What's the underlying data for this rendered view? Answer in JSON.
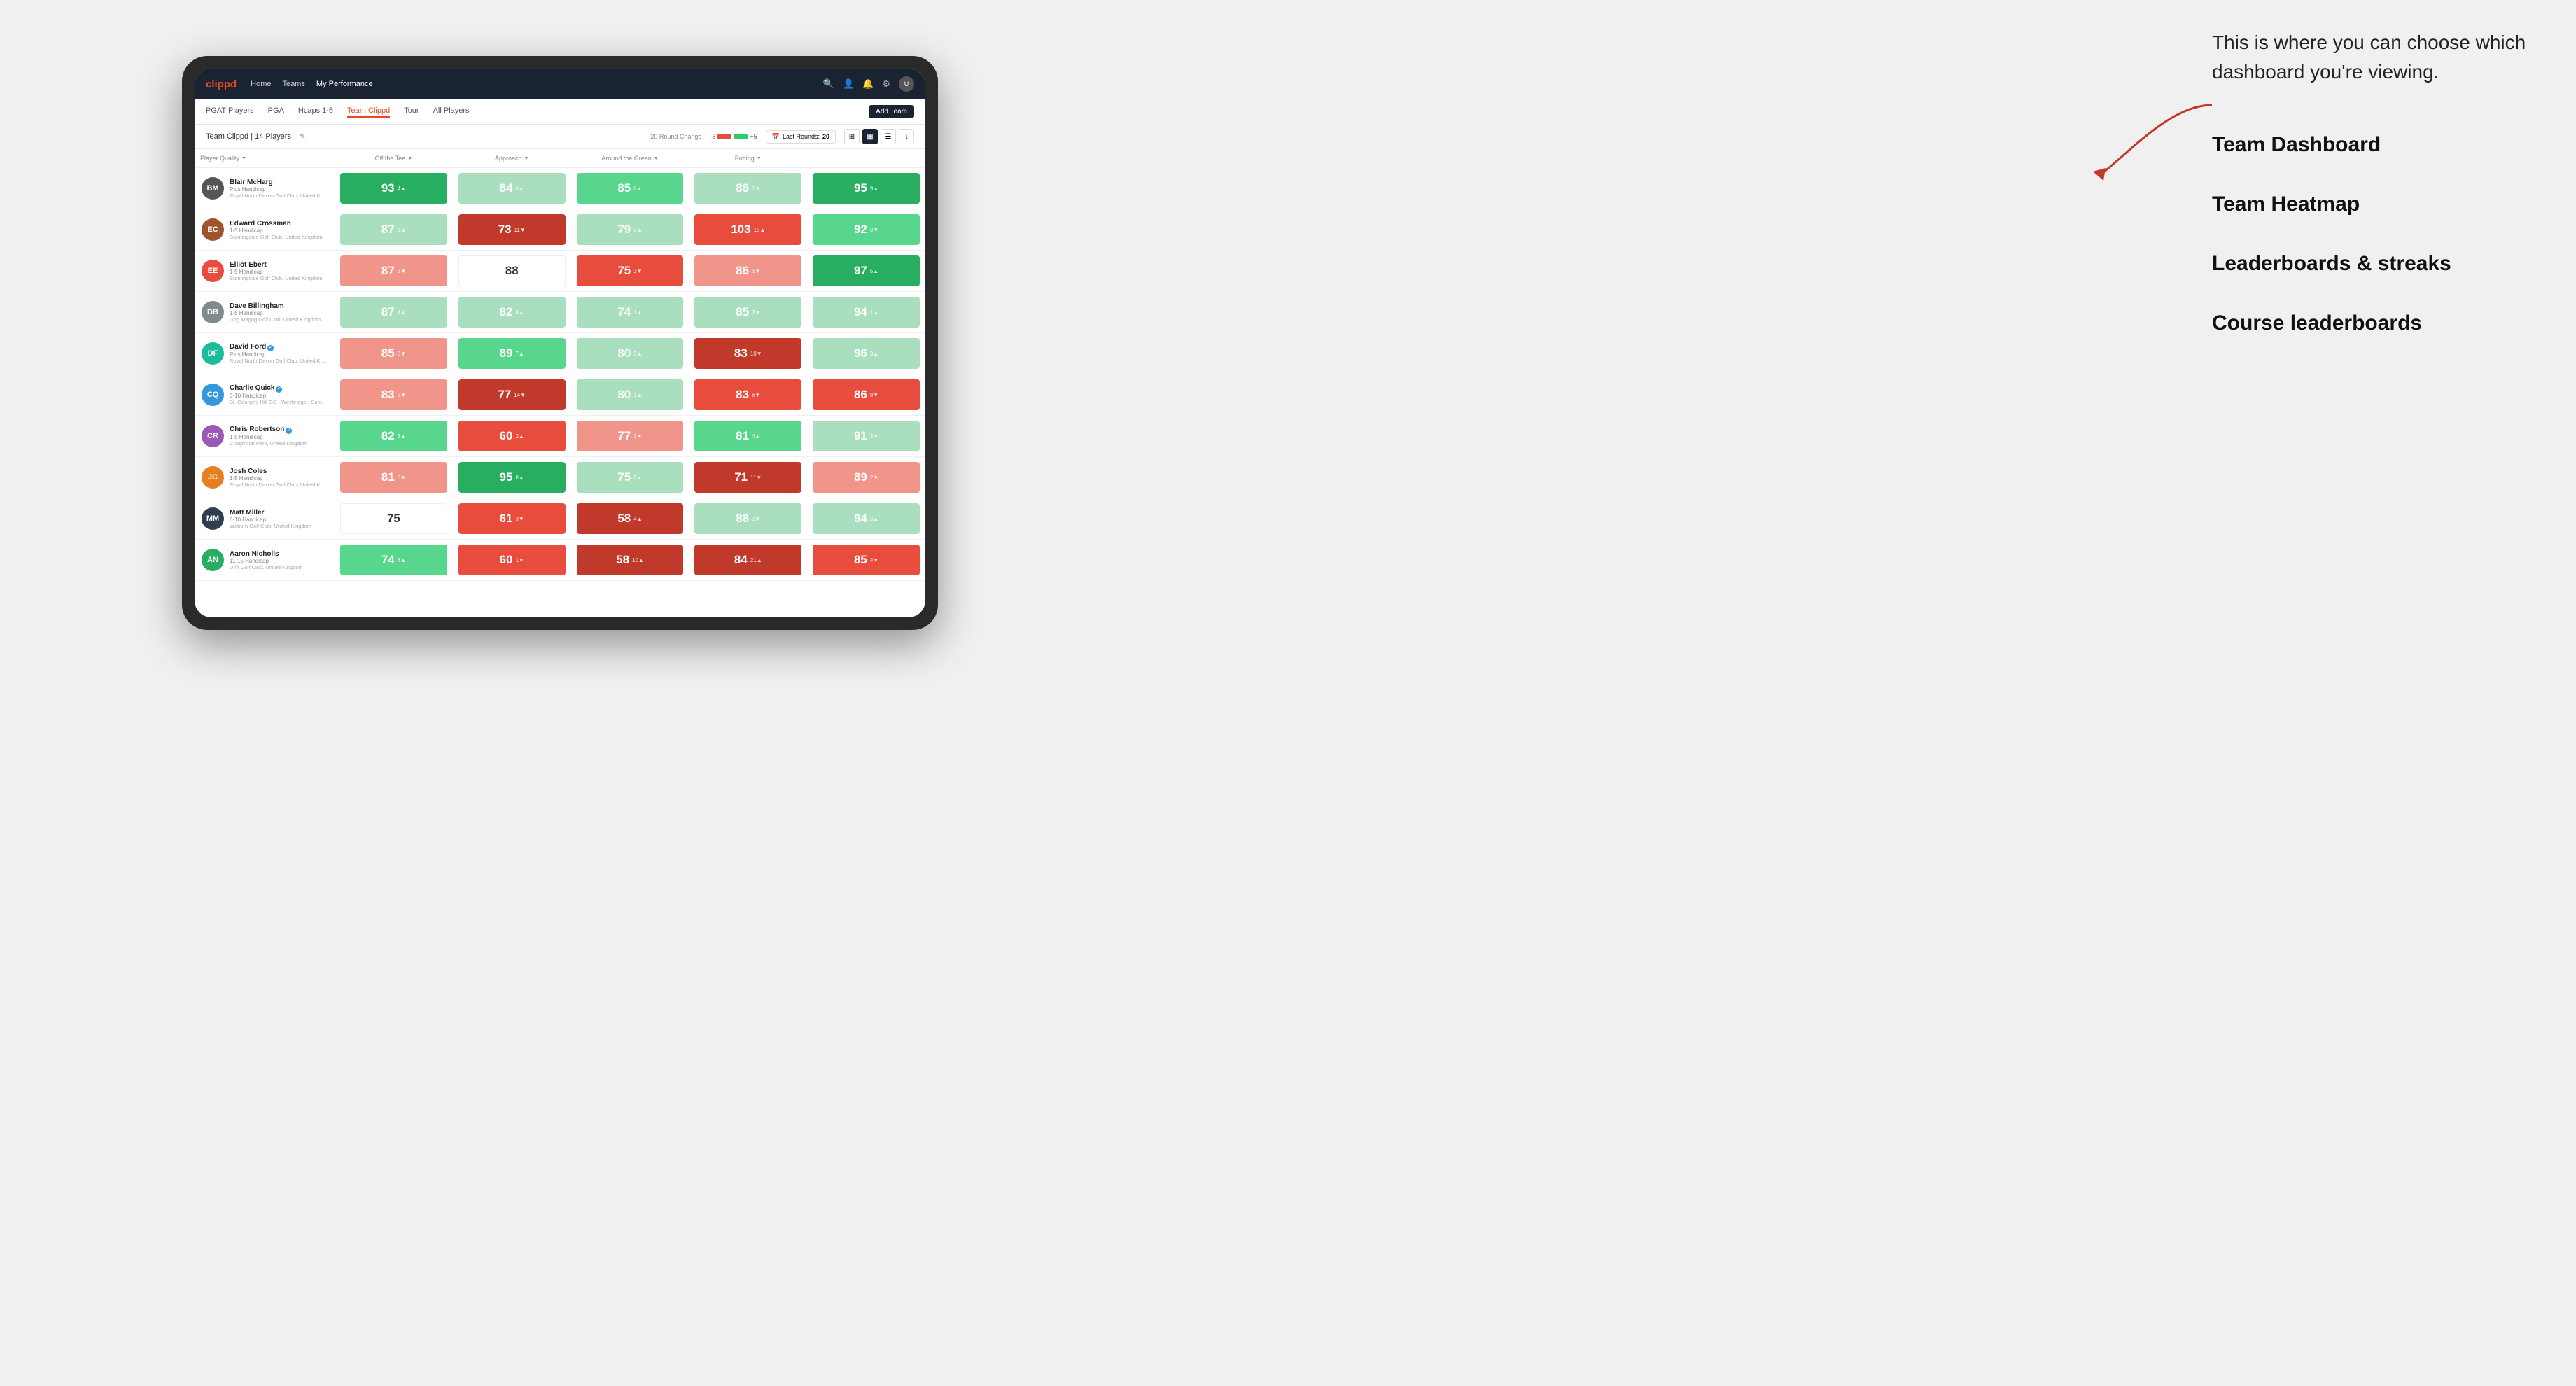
{
  "annotation": {
    "intro": "This is where you can choose which dashboard you're viewing.",
    "items": [
      "Team Dashboard",
      "Team Heatmap",
      "Leaderboards & streaks",
      "Course leaderboards"
    ]
  },
  "nav": {
    "logo": "clippd",
    "links": [
      "Home",
      "Teams",
      "My Performance"
    ],
    "active_link": "My Performance"
  },
  "sub_nav": {
    "links": [
      "PGAT Players",
      "PGA",
      "Hcaps 1-5",
      "Team Clippd",
      "Tour",
      "All Players"
    ],
    "active": "Team Clippd",
    "add_team_label": "Add Team"
  },
  "team_bar": {
    "team_name": "Team Clippd | 14 Players",
    "round_change_label": "20 Round Change",
    "neg_label": "-5",
    "pos_label": "+5",
    "last_rounds_label": "Last Rounds:",
    "last_rounds_value": "20"
  },
  "table": {
    "columns": [
      "Player Quality ▼",
      "Off the Tee ▼",
      "Approach ▼",
      "Around the Green ▼",
      "Putting ▼"
    ],
    "players": [
      {
        "name": "Blair McHarg",
        "handicap": "Plus Handicap",
        "club": "Royal North Devon Golf Club, United Kingdom",
        "initials": "BM",
        "avatar_color": "av-dark",
        "scores": [
          {
            "value": "93",
            "change": "4",
            "dir": "up",
            "color": "bg-green-strong"
          },
          {
            "value": "84",
            "change": "6",
            "dir": "up",
            "color": "bg-green-light"
          },
          {
            "value": "85",
            "change": "8",
            "dir": "up",
            "color": "bg-green-medium"
          },
          {
            "value": "88",
            "change": "1",
            "dir": "down",
            "color": "bg-green-light"
          },
          {
            "value": "95",
            "change": "9",
            "dir": "up",
            "color": "bg-green-strong"
          }
        ]
      },
      {
        "name": "Edward Crossman",
        "handicap": "1-5 Handicap",
        "club": "Sunningdale Golf Club, United Kingdom",
        "initials": "EC",
        "avatar_color": "av-brown",
        "scores": [
          {
            "value": "87",
            "change": "1",
            "dir": "up",
            "color": "bg-green-light"
          },
          {
            "value": "73",
            "change": "11",
            "dir": "down",
            "color": "bg-red-strong"
          },
          {
            "value": "79",
            "change": "9",
            "dir": "up",
            "color": "bg-green-light"
          },
          {
            "value": "103",
            "change": "15",
            "dir": "up",
            "color": "bg-red-medium"
          },
          {
            "value": "92",
            "change": "3",
            "dir": "down",
            "color": "bg-green-medium"
          }
        ]
      },
      {
        "name": "Elliot Ebert",
        "handicap": "1-5 Handicap",
        "club": "Sunningdale Golf Club, United Kingdom",
        "initials": "EE",
        "avatar_color": "av-red",
        "scores": [
          {
            "value": "87",
            "change": "3",
            "dir": "down",
            "color": "bg-red-light"
          },
          {
            "value": "88",
            "change": "",
            "dir": "none",
            "color": "bg-white"
          },
          {
            "value": "75",
            "change": "3",
            "dir": "down",
            "color": "bg-red-medium"
          },
          {
            "value": "86",
            "change": "6",
            "dir": "down",
            "color": "bg-red-light"
          },
          {
            "value": "97",
            "change": "5",
            "dir": "up",
            "color": "bg-green-strong"
          }
        ]
      },
      {
        "name": "Dave Billingham",
        "handicap": "1-5 Handicap",
        "club": "Gog Magog Golf Club, United Kingdom",
        "initials": "DB",
        "avatar_color": "av-gray",
        "scores": [
          {
            "value": "87",
            "change": "4",
            "dir": "up",
            "color": "bg-green-light"
          },
          {
            "value": "82",
            "change": "4",
            "dir": "up",
            "color": "bg-green-light"
          },
          {
            "value": "74",
            "change": "1",
            "dir": "up",
            "color": "bg-green-light"
          },
          {
            "value": "85",
            "change": "3",
            "dir": "down",
            "color": "bg-green-light"
          },
          {
            "value": "94",
            "change": "1",
            "dir": "up",
            "color": "bg-green-light"
          }
        ]
      },
      {
        "name": "David Ford",
        "handicap": "Plus Handicap",
        "club": "Royal North Devon Golf Club, United Kingdom",
        "initials": "DF",
        "avatar_color": "av-teal",
        "verified": true,
        "scores": [
          {
            "value": "85",
            "change": "3",
            "dir": "down",
            "color": "bg-red-light"
          },
          {
            "value": "89",
            "change": "7",
            "dir": "up",
            "color": "bg-green-medium"
          },
          {
            "value": "80",
            "change": "3",
            "dir": "up",
            "color": "bg-green-light"
          },
          {
            "value": "83",
            "change": "10",
            "dir": "down",
            "color": "bg-red-strong"
          },
          {
            "value": "96",
            "change": "3",
            "dir": "up",
            "color": "bg-green-light"
          }
        ]
      },
      {
        "name": "Charlie Quick",
        "handicap": "6-10 Handicap",
        "club": "St. George's Hill GC - Weybridge - Surrey, Uni...",
        "initials": "CQ",
        "avatar_color": "av-blue",
        "verified": true,
        "scores": [
          {
            "value": "83",
            "change": "3",
            "dir": "down",
            "color": "bg-red-light"
          },
          {
            "value": "77",
            "change": "14",
            "dir": "down",
            "color": "bg-red-strong"
          },
          {
            "value": "80",
            "change": "1",
            "dir": "up",
            "color": "bg-green-light"
          },
          {
            "value": "83",
            "change": "6",
            "dir": "down",
            "color": "bg-red-medium"
          },
          {
            "value": "86",
            "change": "8",
            "dir": "down",
            "color": "bg-red-medium"
          }
        ]
      },
      {
        "name": "Chris Robertson",
        "handicap": "1-5 Handicap",
        "club": "Craigmillar Park, United Kingdom",
        "initials": "CR",
        "avatar_color": "av-purple",
        "verified": true,
        "scores": [
          {
            "value": "82",
            "change": "3",
            "dir": "up",
            "color": "bg-green-medium"
          },
          {
            "value": "60",
            "change": "2",
            "dir": "up",
            "color": "bg-red-medium"
          },
          {
            "value": "77",
            "change": "3",
            "dir": "down",
            "color": "bg-red-light"
          },
          {
            "value": "81",
            "change": "4",
            "dir": "up",
            "color": "bg-green-medium"
          },
          {
            "value": "91",
            "change": "3",
            "dir": "down",
            "color": "bg-green-light"
          }
        ]
      },
      {
        "name": "Josh Coles",
        "handicap": "1-5 Handicap",
        "club": "Royal North Devon Golf Club, United Kingdom",
        "initials": "JC",
        "avatar_color": "av-orange",
        "scores": [
          {
            "value": "81",
            "change": "3",
            "dir": "down",
            "color": "bg-red-light"
          },
          {
            "value": "95",
            "change": "8",
            "dir": "up",
            "color": "bg-green-strong"
          },
          {
            "value": "75",
            "change": "2",
            "dir": "up",
            "color": "bg-green-light"
          },
          {
            "value": "71",
            "change": "11",
            "dir": "down",
            "color": "bg-red-strong"
          },
          {
            "value": "89",
            "change": "2",
            "dir": "down",
            "color": "bg-red-light"
          }
        ]
      },
      {
        "name": "Matt Miller",
        "handicap": "6-10 Handicap",
        "club": "Woburn Golf Club, United Kingdom",
        "initials": "MM",
        "avatar_color": "av-navy",
        "scores": [
          {
            "value": "75",
            "change": "",
            "dir": "none",
            "color": "bg-white"
          },
          {
            "value": "61",
            "change": "3",
            "dir": "down",
            "color": "bg-red-medium"
          },
          {
            "value": "58",
            "change": "4",
            "dir": "up",
            "color": "bg-red-strong"
          },
          {
            "value": "88",
            "change": "2",
            "dir": "down",
            "color": "bg-green-light"
          },
          {
            "value": "94",
            "change": "3",
            "dir": "up",
            "color": "bg-green-light"
          }
        ]
      },
      {
        "name": "Aaron Nicholls",
        "handicap": "11-15 Handicap",
        "club": "Drift Golf Club, United Kingdom",
        "initials": "AN",
        "avatar_color": "av-green",
        "scores": [
          {
            "value": "74",
            "change": "8",
            "dir": "up",
            "color": "bg-green-medium"
          },
          {
            "value": "60",
            "change": "1",
            "dir": "down",
            "color": "bg-red-medium"
          },
          {
            "value": "58",
            "change": "10",
            "dir": "up",
            "color": "bg-red-strong"
          },
          {
            "value": "84",
            "change": "21",
            "dir": "up",
            "color": "bg-red-strong"
          },
          {
            "value": "85",
            "change": "4",
            "dir": "down",
            "color": "bg-red-medium"
          }
        ]
      }
    ]
  }
}
